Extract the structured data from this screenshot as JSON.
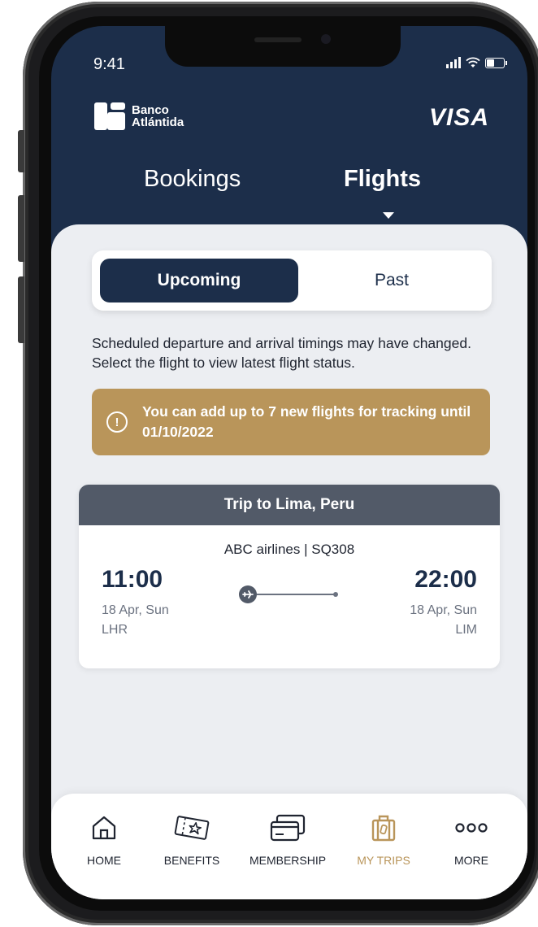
{
  "status_bar": {
    "time": "9:41"
  },
  "header": {
    "bank_name_line1": "Banco",
    "bank_name_line2": "Atlántida",
    "card_brand": "VISA"
  },
  "tabs": [
    {
      "label": "Bookings",
      "active": false
    },
    {
      "label": "Flights",
      "active": true
    }
  ],
  "segment": {
    "upcoming": "Upcoming",
    "past": "Past",
    "selected": "Upcoming"
  },
  "notice": "Scheduled departure and arrival timings may have changed. Select the flight to view latest flight status.",
  "alert": {
    "icon": "exclamation-circle-icon",
    "text": "You can add up to 7 new flights for tracking until 01/10/2022"
  },
  "trip": {
    "title": "Trip  to Lima, Peru",
    "airline_flight": "ABC airlines | SQ308",
    "departure": {
      "time": "11:00",
      "date": "18 Apr, Sun",
      "airport": "LHR"
    },
    "arrival": {
      "time": "22:00",
      "date": "18 Apr, Sun",
      "airport": "LIM"
    }
  },
  "bottom_nav": [
    {
      "label": "HOME",
      "icon": "home-icon",
      "active": false
    },
    {
      "label": "BENEFITS",
      "icon": "ticket-star-icon",
      "active": false
    },
    {
      "label": "MEMBERSHIP",
      "icon": "cards-icon",
      "active": false
    },
    {
      "label": "MY TRIPS",
      "icon": "luggage-icon",
      "active": true
    },
    {
      "label": "MORE",
      "icon": "more-dots-icon",
      "active": false
    }
  ],
  "colors": {
    "navy": "#1c2e4a",
    "gold": "#b9955a",
    "slate": "#525a68",
    "background": "#eceef2"
  }
}
